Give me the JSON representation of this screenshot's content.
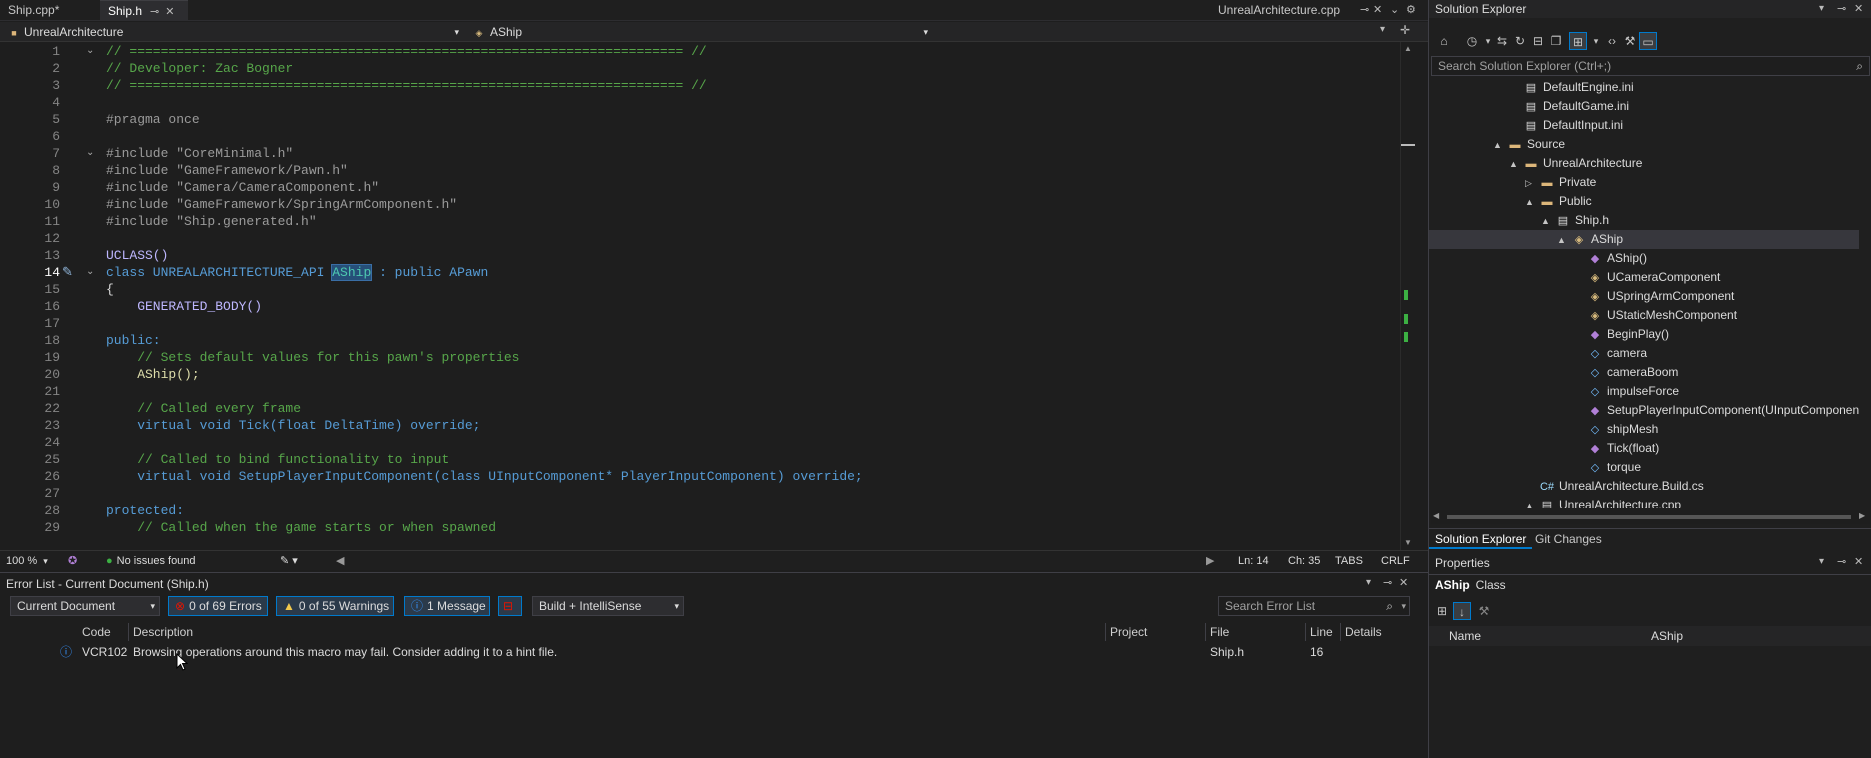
{
  "tabs": {
    "tab1": "Ship.cpp*",
    "tab2": "Ship.h",
    "tab3": "UnrealArchitecture.cpp"
  },
  "nav": {
    "project": "UnrealArchitecture",
    "scope": "AShip"
  },
  "code_lines": [
    {
      "n": "1",
      "t": "// ======================================================================= //",
      "c": "cm"
    },
    {
      "n": "2",
      "t": "// Developer: Zac Bogner",
      "c": "cm"
    },
    {
      "n": "3",
      "t": "// ======================================================================= //",
      "c": "cm"
    },
    {
      "n": "4",
      "t": "",
      "c": "id"
    },
    {
      "n": "5",
      "t": "#pragma once",
      "c": "pr"
    },
    {
      "n": "6",
      "t": "",
      "c": "id"
    },
    {
      "n": "7",
      "t": "#include \"CoreMinimal.h\"",
      "c": "pp"
    },
    {
      "n": "8",
      "t": "#include \"GameFramework/Pawn.h\"",
      "c": "pp"
    },
    {
      "n": "9",
      "t": "#include \"Camera/CameraComponent.h\"",
      "c": "pp"
    },
    {
      "n": "10",
      "t": "#include \"GameFramework/SpringArmComponent.h\"",
      "c": "pp"
    },
    {
      "n": "11",
      "t": "#include \"Ship.generated.h\"",
      "c": "pp"
    },
    {
      "n": "12",
      "t": "",
      "c": "id"
    },
    {
      "n": "13",
      "t": "UCLASS()",
      "c": "mc"
    },
    {
      "n": "14",
      "t": "class UNREALARCHITECTURE_API AShip : public APawn",
      "c": "kw"
    },
    {
      "n": "15",
      "t": "{",
      "c": "id"
    },
    {
      "n": "16",
      "t": "    GENERATED_BODY()",
      "c": "mc"
    },
    {
      "n": "17",
      "t": "",
      "c": "id"
    },
    {
      "n": "18",
      "t": "public:",
      "c": "kw"
    },
    {
      "n": "19",
      "t": "    // Sets default values for this pawn's properties",
      "c": "cm"
    },
    {
      "n": "20",
      "t": "    AShip();",
      "c": "fn"
    },
    {
      "n": "21",
      "t": "",
      "c": "id"
    },
    {
      "n": "22",
      "t": "    // Called every frame",
      "c": "cm"
    },
    {
      "n": "23",
      "t": "    virtual void Tick(float DeltaTime) override;",
      "c": "kw"
    },
    {
      "n": "24",
      "t": "",
      "c": "id"
    },
    {
      "n": "25",
      "t": "    // Called to bind functionality to input",
      "c": "cm"
    },
    {
      "n": "26",
      "t": "    virtual void SetupPlayerInputComponent(class UInputComponent* PlayerInputComponent) override;",
      "c": "kw"
    },
    {
      "n": "27",
      "t": "",
      "c": "id"
    },
    {
      "n": "28",
      "t": "protected:",
      "c": "kw"
    },
    {
      "n": "29",
      "t": "    // Called when the game starts or when spawned",
      "c": "cm"
    }
  ],
  "status": {
    "zoom": "100 %",
    "issues": "No issues found",
    "line": "Ln: 14",
    "col": "Ch: 35",
    "tabs": "TABS",
    "eol": "CRLF"
  },
  "error_list": {
    "title": "Error List - Current Document (Ship.h)",
    "scope": "Current Document",
    "errors": "0 of 69 Errors",
    "warnings": "0 of 55 Warnings",
    "messages": "1 Message",
    "build": "Build + IntelliSense",
    "search": "Search Error List",
    "cols": {
      "code": "Code",
      "desc": "Description",
      "project": "Project",
      "file": "File",
      "line": "Line",
      "details": "Details"
    },
    "row": {
      "code": "VCR102",
      "desc": "Browsing operations around this macro may fail. Consider adding it to a hint file.",
      "file": "Ship.h",
      "line": "16"
    }
  },
  "solution_explorer": {
    "title": "Solution Explorer",
    "search": "Search Solution Explorer (Ctrl+;)",
    "items": [
      {
        "label": "DefaultEngine.ini",
        "icon": "file"
      },
      {
        "label": "DefaultGame.ini",
        "icon": "file"
      },
      {
        "label": "DefaultInput.ini",
        "icon": "file"
      },
      {
        "label": "Source",
        "icon": "folder"
      },
      {
        "label": "UnrealArchitecture",
        "icon": "folder"
      },
      {
        "label": "Private",
        "icon": "folder"
      },
      {
        "label": "Public",
        "icon": "folder"
      },
      {
        "label": "Ship.h",
        "icon": "file"
      },
      {
        "label": "AShip",
        "icon": "cls"
      },
      {
        "label": "AShip()",
        "icon": "fn"
      },
      {
        "label": "UCameraComponent",
        "icon": "cls"
      },
      {
        "label": "USpringArmComponent",
        "icon": "cls"
      },
      {
        "label": "UStaticMeshComponent",
        "icon": "cls"
      },
      {
        "label": "BeginPlay()",
        "icon": "fn"
      },
      {
        "label": "camera",
        "icon": "fld"
      },
      {
        "label": "cameraBoom",
        "icon": "fld"
      },
      {
        "label": "impulseForce",
        "icon": "fld"
      },
      {
        "label": "SetupPlayerInputComponent(UInputComponent *",
        "icon": "fn"
      },
      {
        "label": "shipMesh",
        "icon": "fld"
      },
      {
        "label": "Tick(float)",
        "icon": "fn"
      },
      {
        "label": "torque",
        "icon": "fld"
      },
      {
        "label": "UnrealArchitecture.Build.cs",
        "icon": "cs"
      },
      {
        "label": "UnrealArchitecture.cpp",
        "icon": "file"
      }
    ],
    "tab_solution": "Solution Explorer",
    "tab_git": "Git Changes"
  },
  "properties": {
    "title": "Properties",
    "object": "AShip",
    "kind": "Class",
    "name_label": "Name",
    "name_value": "AShip"
  },
  "colors": {
    "accent": "#007acc",
    "selection": "#37373d"
  }
}
